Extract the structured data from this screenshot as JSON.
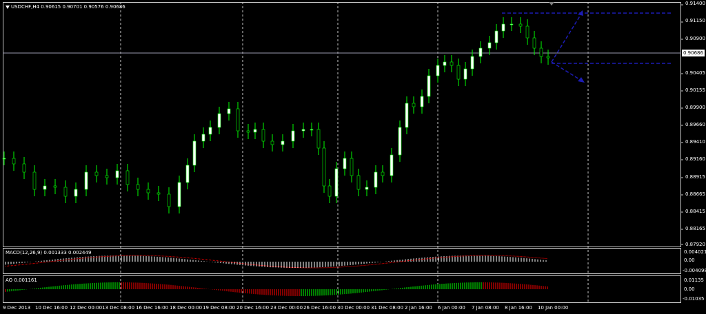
{
  "main": {
    "symbol_line": "USDCHF,H4  0.90615 0.90701 0.90576 0.90686",
    "current_price": "0.90686",
    "price_labels": [
      "0.91400",
      "0.91150",
      "0.90900",
      "0.90405",
      "0.90155",
      "0.89900",
      "0.89660",
      "0.89410",
      "0.89160",
      "0.88915",
      "0.88665",
      "0.88415",
      "0.88165",
      "0.87920"
    ]
  },
  "macd": {
    "title": "MACD(12,26,9) 0.001333 0.002449",
    "labels": [
      "0.004021",
      "0.00",
      "-0.004098"
    ]
  },
  "ao": {
    "title": "AO 0.001161",
    "labels": [
      "0.01135",
      "0.00",
      "-0.01035"
    ]
  },
  "time_labels": [
    "9 Dec 2013",
    "10 Dec 16:00",
    "12 Dec 00:00",
    "13 Dec 08:00",
    "16 Dec 16:00",
    "18 Dec 00:00",
    "19 Dec 08:00",
    "20 Dec 16:00",
    "23 Dec 00:00",
    "26 Dec 16:00",
    "30 Dec 00:00",
    "31 Dec 08:00",
    "2 Jan 16:00",
    "6 Jan 00:00",
    "7 Jan 08:00",
    "8 Jan 16:00",
    "10 Jan 00:00"
  ],
  "colors": {
    "bull": "#ffffff",
    "bear": "#000000",
    "wick": "#00ff00",
    "grid": "#c8c8c8",
    "arrow": "#1c1cb4",
    "macd_signal": "#ff0000",
    "ao_up": "#00ff00",
    "ao_down": "#ff0000"
  }
}
